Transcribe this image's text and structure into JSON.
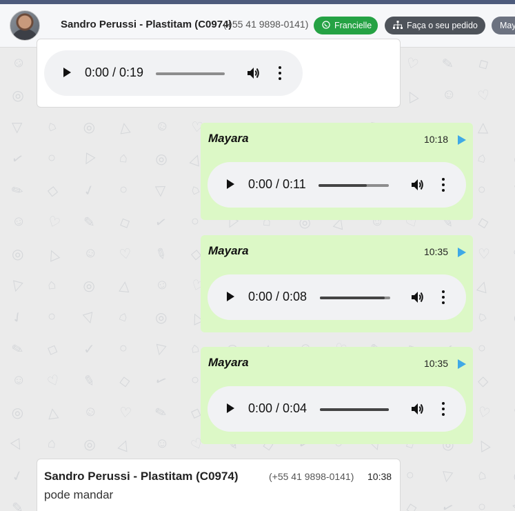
{
  "header": {
    "contact_name": "Sandro Perussi - Plastitam (C0974)",
    "contact_phone": "(+55 41 9898-0141)",
    "buttons": [
      {
        "label": "Francielle",
        "icon": "whatsapp-icon"
      },
      {
        "label": "Faça o seu pedido",
        "icon": "sitemap-icon"
      },
      {
        "label": "May",
        "icon": ""
      }
    ],
    "colors": {
      "green": "#25a244",
      "dark": "#4e535a",
      "gray": "#6c7280"
    }
  },
  "messages": [
    {
      "type": "incoming-audio",
      "audio_time": "0:00 / 0:19",
      "progress": 0
    },
    {
      "type": "outgoing-audio",
      "sender": "Mayara",
      "time": "10:18",
      "audio_time": "0:00 / 0:11",
      "progress": 0.69
    },
    {
      "type": "outgoing-audio",
      "sender": "Mayara",
      "time": "10:35",
      "audio_time": "0:00 / 0:08",
      "progress": 0.92
    },
    {
      "type": "outgoing-audio",
      "sender": "Mayara",
      "time": "10:35",
      "audio_time": "0:00 / 0:04",
      "progress": 1.0
    }
  ],
  "last_message": {
    "sender": "Sandro Perussi - Plastitam (C0974)",
    "phone": "(+55 41 9898-0141)",
    "time": "10:38",
    "text": "pode mandar"
  },
  "colors": {
    "outgoing_bubble": "#dcf8c6",
    "play_indicator": "#3fa9e6",
    "background": "#ebebeb"
  }
}
